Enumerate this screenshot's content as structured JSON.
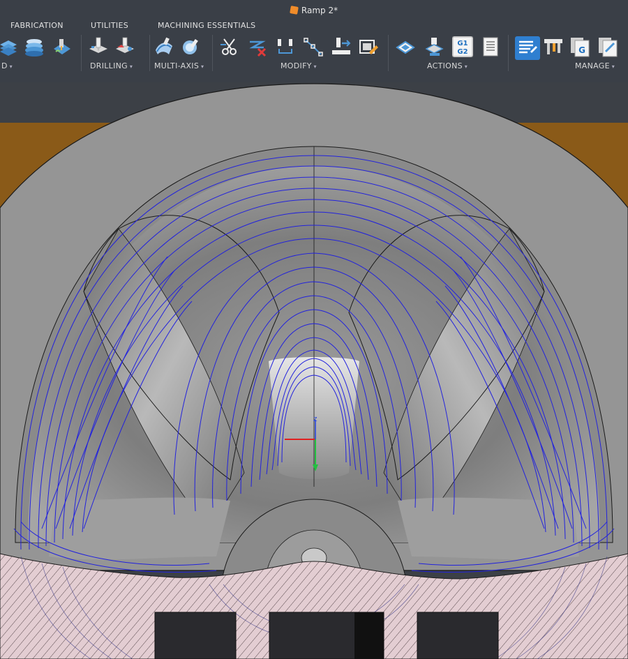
{
  "window": {
    "title": "Ramp 2*"
  },
  "tabs": [
    {
      "label": "FABRICATION"
    },
    {
      "label": "UTILITIES"
    },
    {
      "label": "MACHINING ESSENTIALS"
    }
  ],
  "groups": {
    "partial_left": {
      "label": "D"
    },
    "drilling": {
      "label": "DRILLING"
    },
    "multi_axis": {
      "label": "MULTI-AXIS"
    },
    "modify": {
      "label": "MODIFY"
    },
    "actions": {
      "label": "ACTIONS"
    },
    "manage": {
      "label": "MANAGE"
    }
  },
  "icons": {
    "post_g1g2": {
      "line1": "G1",
      "line2": "G2"
    },
    "setup_sheet_g": {
      "label": "G"
    }
  },
  "viewport": {
    "axis_label": "Z",
    "colors": {
      "toolpath": "#2222dd",
      "stock": "#e2cbd0",
      "background_band": "#8a5a18",
      "part": "#8e8e8e"
    }
  }
}
